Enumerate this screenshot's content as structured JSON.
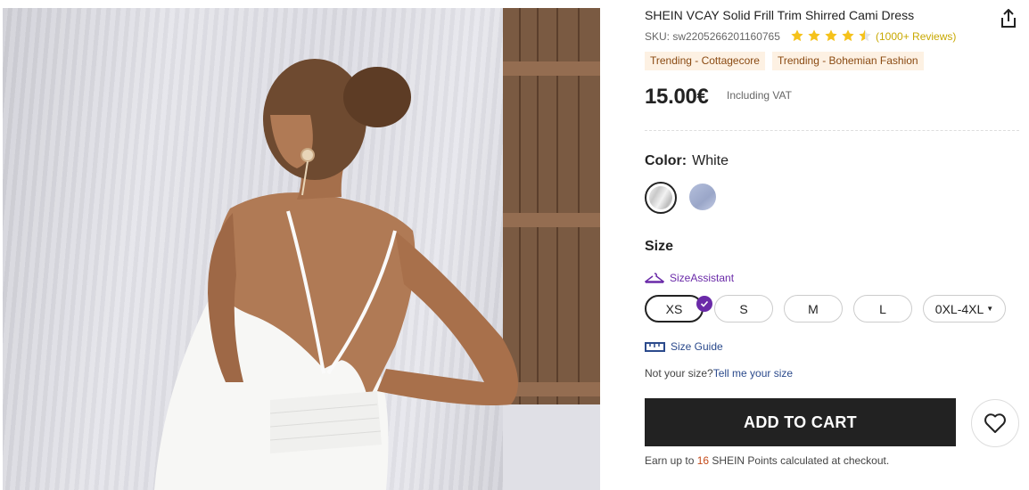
{
  "product": {
    "title": "SHEIN VCAY Solid Frill Trim Shirred Cami Dress",
    "sku": "SKU: sw2205266201160765",
    "rating_stars": 4.5,
    "reviews": "(1000+ Reviews)",
    "tags": [
      "Trending - Cottagecore",
      "Trending - Bohemian Fashion"
    ],
    "price": "15.00€",
    "vat": "Including VAT"
  },
  "color": {
    "label": "Color:",
    "value": "White",
    "options": [
      "White",
      "Blue"
    ]
  },
  "size": {
    "label": "Size",
    "assistant": "SizeAssistant",
    "options": [
      "XS",
      "S",
      "M",
      "L"
    ],
    "selected": "XS",
    "more": "0XL-4XL",
    "guide": "Size Guide",
    "not_your_size": "Not your size?",
    "tell_me": "Tell me your size"
  },
  "actions": {
    "add_to_cart": "ADD TO CART"
  },
  "points": {
    "prefix": "Earn up to ",
    "value": "16",
    "suffix": " SHEIN Points calculated at checkout."
  },
  "colors": {
    "accent_purple": "#6a2aa8",
    "star": "#f5c21b",
    "link": "#2b4a8c",
    "tag_bg": "#fdf1e3",
    "cart_bg": "#222222"
  },
  "icons": [
    "share-icon",
    "star-icon",
    "size-assistant-icon",
    "check-icon",
    "ruler-icon",
    "heart-icon"
  ]
}
